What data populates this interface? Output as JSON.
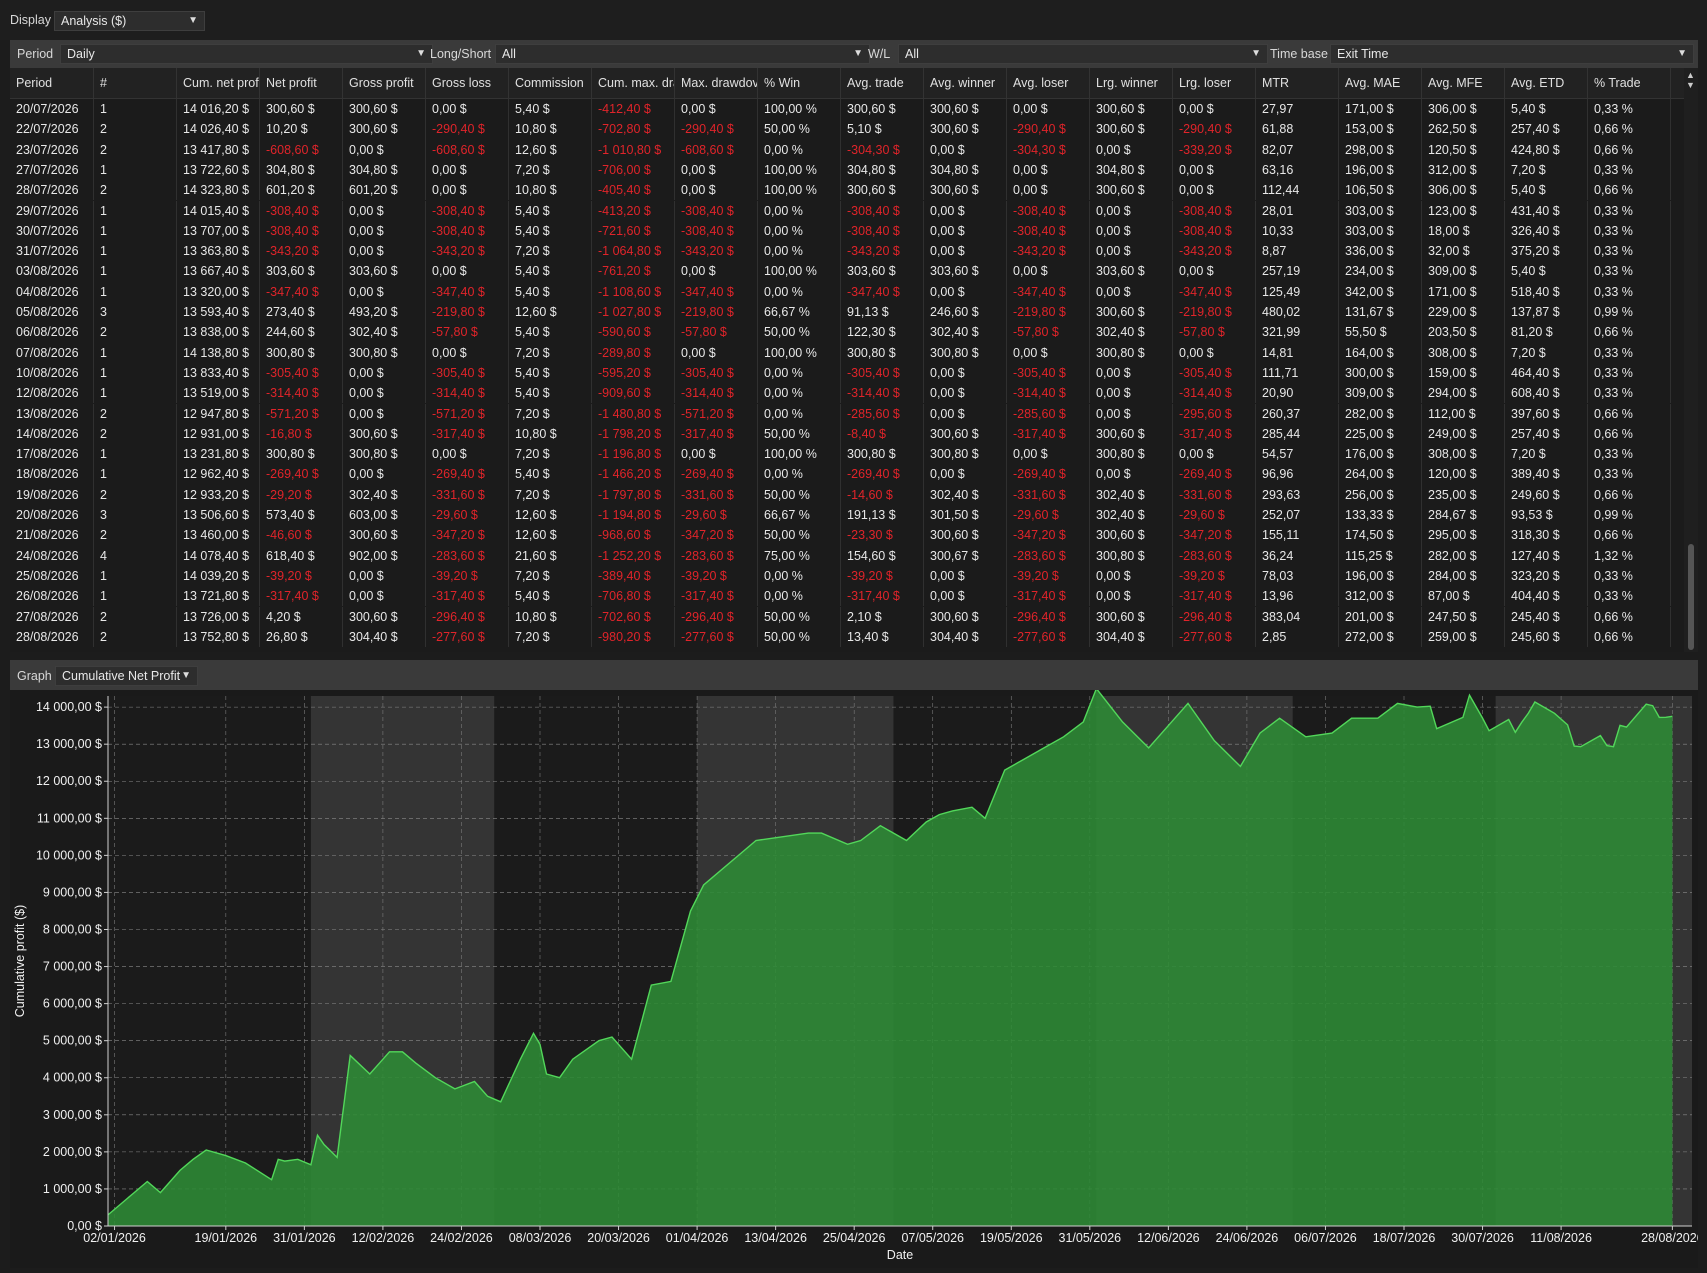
{
  "display": {
    "label": "Display",
    "value": "Analysis ($)"
  },
  "filters": {
    "period": {
      "label": "Period",
      "value": "Daily"
    },
    "longshort": {
      "label": "Long/Short",
      "value": "All"
    },
    "wl": {
      "label": "W/L",
      "value": "All"
    },
    "timebase": {
      "label": "Time base",
      "value": "Exit Time"
    }
  },
  "table": {
    "columns": [
      "Period",
      "#",
      "Cum. net prof",
      "Net profit",
      "Gross profit",
      "Gross loss",
      "Commission",
      "Cum. max. dra",
      "Max. drawdov",
      "% Win",
      "Avg. trade",
      "Avg. winner",
      "Avg. loser",
      "Lrg. winner",
      "Lrg. loser",
      "MTR",
      "Avg. MAE",
      "Avg. MFE",
      "Avg. ETD",
      "% Trade"
    ],
    "rows": [
      [
        "20/07/2026",
        "1",
        "14 016,20 $",
        "300,60 $",
        "300,60 $",
        "0,00 $",
        "5,40 $",
        "-412,40 $",
        "0,00 $",
        "100,00 %",
        "300,60 $",
        "300,60 $",
        "0,00 $",
        "300,60 $",
        "0,00 $",
        "27,97",
        "171,00 $",
        "306,00 $",
        "5,40 $",
        "0,33 %"
      ],
      [
        "22/07/2026",
        "2",
        "14 026,40 $",
        "10,20 $",
        "300,60 $",
        "-290,40 $",
        "10,80 $",
        "-702,80 $",
        "-290,40 $",
        "50,00 %",
        "5,10 $",
        "300,60 $",
        "-290,40 $",
        "300,60 $",
        "-290,40 $",
        "61,88",
        "153,00 $",
        "262,50 $",
        "257,40 $",
        "0,66 %"
      ],
      [
        "23/07/2026",
        "2",
        "13 417,80 $",
        "-608,60 $",
        "0,00 $",
        "-608,60 $",
        "12,60 $",
        "-1 010,80 $",
        "-608,60 $",
        "0,00 %",
        "-304,30 $",
        "0,00 $",
        "-304,30 $",
        "0,00 $",
        "-339,20 $",
        "82,07",
        "298,00 $",
        "120,50 $",
        "424,80 $",
        "0,66 %"
      ],
      [
        "27/07/2026",
        "1",
        "13 722,60 $",
        "304,80 $",
        "304,80 $",
        "0,00 $",
        "7,20 $",
        "-706,00 $",
        "0,00 $",
        "100,00 %",
        "304,80 $",
        "304,80 $",
        "0,00 $",
        "304,80 $",
        "0,00 $",
        "63,16",
        "196,00 $",
        "312,00 $",
        "7,20 $",
        "0,33 %"
      ],
      [
        "28/07/2026",
        "2",
        "14 323,80 $",
        "601,20 $",
        "601,20 $",
        "0,00 $",
        "10,80 $",
        "-405,40 $",
        "0,00 $",
        "100,00 %",
        "300,60 $",
        "300,60 $",
        "0,00 $",
        "300,60 $",
        "0,00 $",
        "112,44",
        "106,50 $",
        "306,00 $",
        "5,40 $",
        "0,66 %"
      ],
      [
        "29/07/2026",
        "1",
        "14 015,40 $",
        "-308,40 $",
        "0,00 $",
        "-308,40 $",
        "5,40 $",
        "-413,20 $",
        "-308,40 $",
        "0,00 %",
        "-308,40 $",
        "0,00 $",
        "-308,40 $",
        "0,00 $",
        "-308,40 $",
        "28,01",
        "303,00 $",
        "123,00 $",
        "431,40 $",
        "0,33 %"
      ],
      [
        "30/07/2026",
        "1",
        "13 707,00 $",
        "-308,40 $",
        "0,00 $",
        "-308,40 $",
        "5,40 $",
        "-721,60 $",
        "-308,40 $",
        "0,00 %",
        "-308,40 $",
        "0,00 $",
        "-308,40 $",
        "0,00 $",
        "-308,40 $",
        "10,33",
        "303,00 $",
        "18,00 $",
        "326,40 $",
        "0,33 %"
      ],
      [
        "31/07/2026",
        "1",
        "13 363,80 $",
        "-343,20 $",
        "0,00 $",
        "-343,20 $",
        "7,20 $",
        "-1 064,80 $",
        "-343,20 $",
        "0,00 %",
        "-343,20 $",
        "0,00 $",
        "-343,20 $",
        "0,00 $",
        "-343,20 $",
        "8,87",
        "336,00 $",
        "32,00 $",
        "375,20 $",
        "0,33 %"
      ],
      [
        "03/08/2026",
        "1",
        "13 667,40 $",
        "303,60 $",
        "303,60 $",
        "0,00 $",
        "5,40 $",
        "-761,20 $",
        "0,00 $",
        "100,00 %",
        "303,60 $",
        "303,60 $",
        "0,00 $",
        "303,60 $",
        "0,00 $",
        "257,19",
        "234,00 $",
        "309,00 $",
        "5,40 $",
        "0,33 %"
      ],
      [
        "04/08/2026",
        "1",
        "13 320,00 $",
        "-347,40 $",
        "0,00 $",
        "-347,40 $",
        "5,40 $",
        "-1 108,60 $",
        "-347,40 $",
        "0,00 %",
        "-347,40 $",
        "0,00 $",
        "-347,40 $",
        "0,00 $",
        "-347,40 $",
        "125,49",
        "342,00 $",
        "171,00 $",
        "518,40 $",
        "0,33 %"
      ],
      [
        "05/08/2026",
        "3",
        "13 593,40 $",
        "273,40 $",
        "493,20 $",
        "-219,80 $",
        "12,60 $",
        "-1 027,80 $",
        "-219,80 $",
        "66,67 %",
        "91,13 $",
        "246,60 $",
        "-219,80 $",
        "300,60 $",
        "-219,80 $",
        "480,02",
        "131,67 $",
        "229,00 $",
        "137,87 $",
        "0,99 %"
      ],
      [
        "06/08/2026",
        "2",
        "13 838,00 $",
        "244,60 $",
        "302,40 $",
        "-57,80 $",
        "5,40 $",
        "-590,60 $",
        "-57,80 $",
        "50,00 %",
        "122,30 $",
        "302,40 $",
        "-57,80 $",
        "302,40 $",
        "-57,80 $",
        "321,99",
        "55,50 $",
        "203,50 $",
        "81,20 $",
        "0,66 %"
      ],
      [
        "07/08/2026",
        "1",
        "14 138,80 $",
        "300,80 $",
        "300,80 $",
        "0,00 $",
        "7,20 $",
        "-289,80 $",
        "0,00 $",
        "100,00 %",
        "300,80 $",
        "300,80 $",
        "0,00 $",
        "300,80 $",
        "0,00 $",
        "14,81",
        "164,00 $",
        "308,00 $",
        "7,20 $",
        "0,33 %"
      ],
      [
        "10/08/2026",
        "1",
        "13 833,40 $",
        "-305,40 $",
        "0,00 $",
        "-305,40 $",
        "5,40 $",
        "-595,20 $",
        "-305,40 $",
        "0,00 %",
        "-305,40 $",
        "0,00 $",
        "-305,40 $",
        "0,00 $",
        "-305,40 $",
        "111,71",
        "300,00 $",
        "159,00 $",
        "464,40 $",
        "0,33 %"
      ],
      [
        "12/08/2026",
        "1",
        "13 519,00 $",
        "-314,40 $",
        "0,00 $",
        "-314,40 $",
        "5,40 $",
        "-909,60 $",
        "-314,40 $",
        "0,00 %",
        "-314,40 $",
        "0,00 $",
        "-314,40 $",
        "0,00 $",
        "-314,40 $",
        "20,90",
        "309,00 $",
        "294,00 $",
        "608,40 $",
        "0,33 %"
      ],
      [
        "13/08/2026",
        "2",
        "12 947,80 $",
        "-571,20 $",
        "0,00 $",
        "-571,20 $",
        "7,20 $",
        "-1 480,80 $",
        "-571,20 $",
        "0,00 %",
        "-285,60 $",
        "0,00 $",
        "-285,60 $",
        "0,00 $",
        "-295,60 $",
        "260,37",
        "282,00 $",
        "112,00 $",
        "397,60 $",
        "0,66 %"
      ],
      [
        "14/08/2026",
        "2",
        "12 931,00 $",
        "-16,80 $",
        "300,60 $",
        "-317,40 $",
        "10,80 $",
        "-1 798,20 $",
        "-317,40 $",
        "50,00 %",
        "-8,40 $",
        "300,60 $",
        "-317,40 $",
        "300,60 $",
        "-317,40 $",
        "285,44",
        "225,00 $",
        "249,00 $",
        "257,40 $",
        "0,66 %"
      ],
      [
        "17/08/2026",
        "1",
        "13 231,80 $",
        "300,80 $",
        "300,80 $",
        "0,00 $",
        "7,20 $",
        "-1 196,80 $",
        "0,00 $",
        "100,00 %",
        "300,80 $",
        "300,80 $",
        "0,00 $",
        "300,80 $",
        "0,00 $",
        "54,57",
        "176,00 $",
        "308,00 $",
        "7,20 $",
        "0,33 %"
      ],
      [
        "18/08/2026",
        "1",
        "12 962,40 $",
        "-269,40 $",
        "0,00 $",
        "-269,40 $",
        "5,40 $",
        "-1 466,20 $",
        "-269,40 $",
        "0,00 %",
        "-269,40 $",
        "0,00 $",
        "-269,40 $",
        "0,00 $",
        "-269,40 $",
        "96,96",
        "264,00 $",
        "120,00 $",
        "389,40 $",
        "0,33 %"
      ],
      [
        "19/08/2026",
        "2",
        "12 933,20 $",
        "-29,20 $",
        "302,40 $",
        "-331,60 $",
        "7,20 $",
        "-1 797,80 $",
        "-331,60 $",
        "50,00 %",
        "-14,60 $",
        "302,40 $",
        "-331,60 $",
        "302,40 $",
        "-331,60 $",
        "293,63",
        "256,00 $",
        "235,00 $",
        "249,60 $",
        "0,66 %"
      ],
      [
        "20/08/2026",
        "3",
        "13 506,60 $",
        "573,40 $",
        "603,00 $",
        "-29,60 $",
        "12,60 $",
        "-1 194,80 $",
        "-29,60 $",
        "66,67 %",
        "191,13 $",
        "301,50 $",
        "-29,60 $",
        "302,40 $",
        "-29,60 $",
        "252,07",
        "133,33 $",
        "284,67 $",
        "93,53 $",
        "0,99 %"
      ],
      [
        "21/08/2026",
        "2",
        "13 460,00 $",
        "-46,60 $",
        "300,60 $",
        "-347,20 $",
        "12,60 $",
        "-968,60 $",
        "-347,20 $",
        "50,00 %",
        "-23,30 $",
        "300,60 $",
        "-347,20 $",
        "300,60 $",
        "-347,20 $",
        "155,11",
        "174,50 $",
        "295,00 $",
        "318,30 $",
        "0,66 %"
      ],
      [
        "24/08/2026",
        "4",
        "14 078,40 $",
        "618,40 $",
        "902,00 $",
        "-283,60 $",
        "21,60 $",
        "-1 252,20 $",
        "-283,60 $",
        "75,00 %",
        "154,60 $",
        "300,67 $",
        "-283,60 $",
        "300,80 $",
        "-283,60 $",
        "36,24",
        "115,25 $",
        "282,00 $",
        "127,40 $",
        "1,32 %"
      ],
      [
        "25/08/2026",
        "1",
        "14 039,20 $",
        "-39,20 $",
        "0,00 $",
        "-39,20 $",
        "7,20 $",
        "-389,40 $",
        "-39,20 $",
        "0,00 %",
        "-39,20 $",
        "0,00 $",
        "-39,20 $",
        "0,00 $",
        "-39,20 $",
        "78,03",
        "196,00 $",
        "284,00 $",
        "323,20 $",
        "0,33 %"
      ],
      [
        "26/08/2026",
        "1",
        "13 721,80 $",
        "-317,40 $",
        "0,00 $",
        "-317,40 $",
        "5,40 $",
        "-706,80 $",
        "-317,40 $",
        "0,00 %",
        "-317,40 $",
        "0,00 $",
        "-317,40 $",
        "0,00 $",
        "-317,40 $",
        "13,96",
        "312,00 $",
        "87,00 $",
        "404,40 $",
        "0,33 %"
      ],
      [
        "27/08/2026",
        "2",
        "13 726,00 $",
        "4,20 $",
        "300,60 $",
        "-296,40 $",
        "10,80 $",
        "-702,60 $",
        "-296,40 $",
        "50,00 %",
        "2,10 $",
        "300,60 $",
        "-296,40 $",
        "300,60 $",
        "-296,40 $",
        "383,04",
        "201,00 $",
        "247,50 $",
        "245,40 $",
        "0,66 %"
      ],
      [
        "28/08/2026",
        "2",
        "13 752,80 $",
        "26,80 $",
        "304,40 $",
        "-277,60 $",
        "7,20 $",
        "-980,20 $",
        "-277,60 $",
        "50,00 %",
        "13,40 $",
        "304,40 $",
        "-277,60 $",
        "304,40 $",
        "-277,60 $",
        "2,85",
        "272,00 $",
        "259,00 $",
        "245,60 $",
        "0,66 %"
      ]
    ]
  },
  "graph_selector": {
    "label": "Graph",
    "value": "Cumulative Net Profit"
  },
  "colors": {
    "positive": "#e8e8e8",
    "negative": "#e0242a",
    "area_fill": "#2e8b35",
    "area_line": "#52d75a",
    "band": "#343434"
  },
  "chart_data": {
    "type": "area",
    "title": "",
    "xlabel": "Date",
    "ylabel": "Cumulative profit ($)",
    "ylim": [
      0,
      14300
    ],
    "xlim": [
      "2026-01-01",
      "2026-08-31"
    ],
    "grid": true,
    "y_ticks": [
      0,
      1000,
      2000,
      3000,
      4000,
      5000,
      6000,
      7000,
      8000,
      9000,
      10000,
      11000,
      12000,
      13000,
      14000
    ],
    "y_tick_labels": [
      "0,00 $",
      "1 000,00 $",
      "2 000,00 $",
      "3 000,00 $",
      "4 000,00 $",
      "5 000,00 $",
      "6 000,00 $",
      "7 000,00 $",
      "8 000,00 $",
      "9 000,00 $",
      "10 000,00 $",
      "11 000,00 $",
      "12 000,00 $",
      "13 000,00 $",
      "14 000,00 $"
    ],
    "x_ticks": [
      "2026-01-02",
      "2026-01-19",
      "2026-01-31",
      "2026-02-12",
      "2026-02-24",
      "2026-03-08",
      "2026-03-20",
      "2026-04-01",
      "2026-04-13",
      "2026-04-25",
      "2026-05-07",
      "2026-05-19",
      "2026-05-31",
      "2026-06-12",
      "2026-06-24",
      "2026-07-06",
      "2026-07-18",
      "2026-07-30",
      "2026-08-11",
      "2026-08-28"
    ],
    "x_tick_labels": [
      "02/01/2026",
      "19/01/2026",
      "31/01/2026",
      "12/02/2026",
      "24/02/2026",
      "08/03/2026",
      "20/03/2026",
      "01/04/2026",
      "13/04/2026",
      "25/04/2026",
      "07/05/2026",
      "19/05/2026",
      "31/05/2026",
      "12/06/2026",
      "24/06/2026",
      "06/07/2026",
      "18/07/2026",
      "30/07/2026",
      "11/08/2026",
      "28/08/2026"
    ],
    "shaded_months": [
      [
        "2026-02-01",
        "2026-03-01"
      ],
      [
        "2026-04-01",
        "2026-05-01"
      ],
      [
        "2026-06-01",
        "2026-07-01"
      ],
      [
        "2026-08-01",
        "2026-08-31"
      ]
    ],
    "series": [
      {
        "x": [
          "2026-01-01",
          "2026-01-05",
          "2026-01-07",
          "2026-01-09",
          "2026-01-12",
          "2026-01-14",
          "2026-01-16",
          "2026-01-19",
          "2026-01-22",
          "2026-01-26",
          "2026-01-27",
          "2026-01-28",
          "2026-01-30",
          "2026-02-01",
          "2026-02-02",
          "2026-02-03",
          "2026-02-05",
          "2026-02-07",
          "2026-02-10",
          "2026-02-13",
          "2026-02-15",
          "2026-02-17",
          "2026-02-20",
          "2026-02-23",
          "2026-02-26",
          "2026-02-28",
          "2026-03-02",
          "2026-03-05",
          "2026-03-07",
          "2026-03-08",
          "2026-03-09",
          "2026-03-11",
          "2026-03-13",
          "2026-03-17",
          "2026-03-19",
          "2026-03-22",
          "2026-03-25",
          "2026-03-28",
          "2026-03-31",
          "2026-04-02",
          "2026-04-10",
          "2026-04-18",
          "2026-04-20",
          "2026-04-24",
          "2026-04-26",
          "2026-04-29",
          "2026-05-03",
          "2026-05-06",
          "2026-05-08",
          "2026-05-10",
          "2026-05-13",
          "2026-05-15",
          "2026-05-18",
          "2026-05-21",
          "2026-05-24",
          "2026-05-27",
          "2026-05-30",
          "2026-06-01",
          "2026-06-05",
          "2026-06-09",
          "2026-06-13",
          "2026-06-15",
          "2026-06-19",
          "2026-06-23",
          "2026-06-26",
          "2026-06-29",
          "2026-07-03",
          "2026-07-07",
          "2026-07-10",
          "2026-07-14",
          "2026-07-17",
          "2026-07-20",
          "2026-07-22",
          "2026-07-23",
          "2026-07-27",
          "2026-07-28",
          "2026-07-29",
          "2026-07-30",
          "2026-07-31",
          "2026-08-03",
          "2026-08-04",
          "2026-08-05",
          "2026-08-06",
          "2026-08-07",
          "2026-08-10",
          "2026-08-12",
          "2026-08-13",
          "2026-08-14",
          "2026-08-17",
          "2026-08-18",
          "2026-08-19",
          "2026-08-20",
          "2026-08-21",
          "2026-08-24",
          "2026-08-25",
          "2026-08-26",
          "2026-08-27",
          "2026-08-28"
        ],
        "y": [
          300,
          900,
          1200,
          900,
          1500,
          1800,
          2050,
          1900,
          1700,
          1250,
          1800,
          1750,
          1800,
          1650,
          2450,
          2200,
          1850,
          4600,
          4100,
          4700,
          4700,
          4400,
          4000,
          3700,
          3900,
          3500,
          3350,
          4500,
          5200,
          4900,
          4100,
          4000,
          4500,
          5000,
          5100,
          4500,
          6500,
          6600,
          8500,
          9200,
          10400,
          10600,
          10600,
          10300,
          10400,
          10800,
          10400,
          10900,
          11100,
          11200,
          11300,
          11000,
          12300,
          12600,
          12900,
          13200,
          13600,
          14500,
          13600,
          12900,
          13700,
          14100,
          13100,
          12400,
          13300,
          13700,
          13200,
          13300,
          13700,
          13700,
          14100,
          14000,
          14026,
          13418,
          13723,
          14324,
          14015,
          13707,
          13364,
          13667,
          13320,
          13593,
          13838,
          14139,
          13833,
          13519,
          12948,
          12931,
          13232,
          12962,
          12933,
          13507,
          13460,
          14078,
          14039,
          13722,
          13726,
          13753
        ]
      }
    ]
  }
}
